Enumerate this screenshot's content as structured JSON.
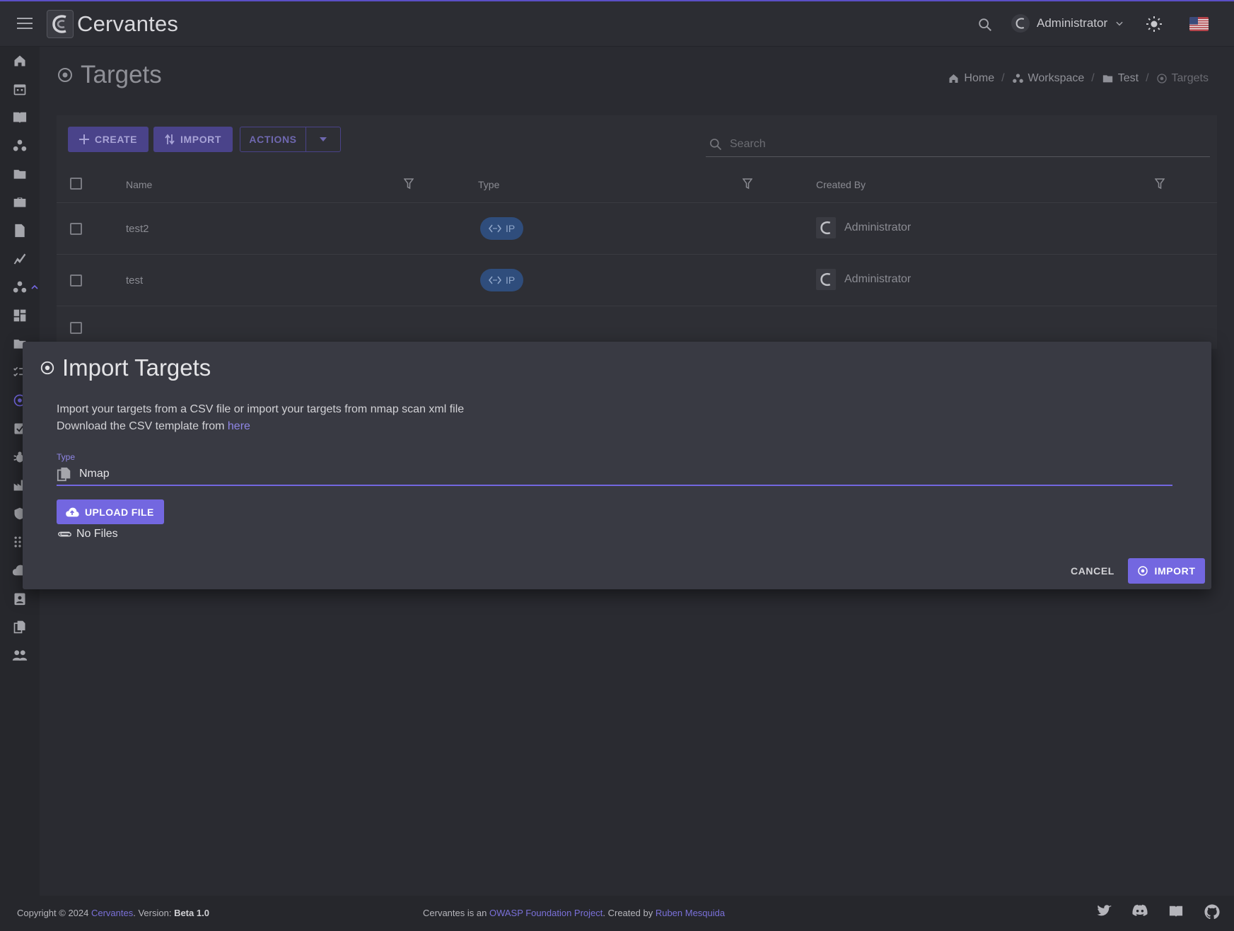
{
  "app": {
    "brand": "Cervantes"
  },
  "header": {
    "user_name": "Administrator"
  },
  "page": {
    "title": "Targets"
  },
  "breadcrumb": [
    {
      "label": "Home"
    },
    {
      "label": "Workspace"
    },
    {
      "label": "Test"
    },
    {
      "label": "Targets"
    }
  ],
  "toolbar": {
    "create_label": "CREATE",
    "import_label": "IMPORT",
    "actions_label": "ACTIONS",
    "search_placeholder": "Search"
  },
  "table": {
    "columns": [
      "Name",
      "Type",
      "Created By"
    ],
    "rows": [
      {
        "name": "test2",
        "type": "IP",
        "created_by": "Administrator"
      },
      {
        "name": "test",
        "type": "IP",
        "created_by": "Administrator"
      }
    ]
  },
  "dialog": {
    "title": "Import Targets",
    "desc_line1": "Import your targets from a CSV file or import your targets from nmap scan xml file",
    "desc_line2_prefix": "Download the CSV template from",
    "desc_link": "here",
    "type_label": "Type",
    "type_value": "Nmap",
    "upload_label": "UPLOAD FILE",
    "no_files": "No Files",
    "cancel_label": "CANCEL",
    "import_label": "IMPORT"
  },
  "footer": {
    "copyright_prefix": "Copyright © 2024",
    "copyright_brand": "Cervantes",
    "version_prefix": ". Version:",
    "version": "Beta 1.0",
    "mid_prefix": "Cervantes is an",
    "mid_link": "OWASP Foundation Project",
    "mid_created": ". Created by",
    "mid_author": "Ruben Mesquida"
  },
  "colors": {
    "accent": "#7367e0",
    "chip": "#2f4d7c",
    "background": "#2a2b31"
  }
}
